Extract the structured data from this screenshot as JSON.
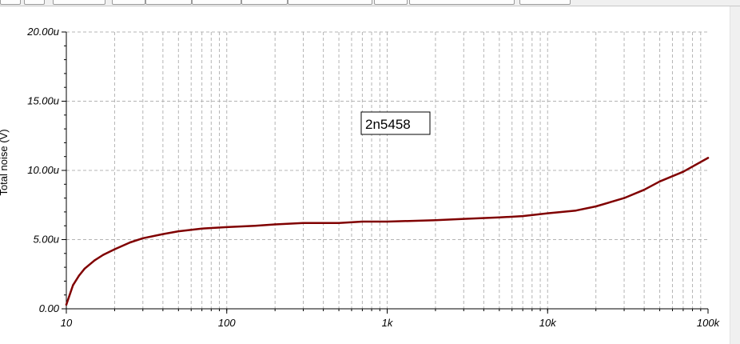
{
  "chart_data": {
    "type": "line",
    "title": "",
    "xlabel": "",
    "ylabel": "Total noise (V)",
    "x_scale": "log",
    "xlim": [
      10,
      100000
    ],
    "ylim": [
      0,
      2e-05
    ],
    "grid": true,
    "x_tick_values": [
      10,
      100,
      1000,
      10000,
      100000
    ],
    "x_tick_labels": [
      "10",
      "100",
      "1k",
      "10k",
      "100k"
    ],
    "y_tick_values": [
      0,
      5e-06,
      1e-05,
      1.5e-05,
      2e-05
    ],
    "y_tick_labels": [
      "0.00",
      "5.00u",
      "10.00u",
      "15.00u",
      "20.00u"
    ],
    "legend_label": "2n5458",
    "series": [
      {
        "name": "2n5458",
        "color": "#800000",
        "x": [
          10,
          11,
          12,
          13,
          15,
          17,
          20,
          25,
          30,
          40,
          50,
          70,
          100,
          150,
          200,
          300,
          500,
          700,
          1000,
          2000,
          3000,
          5000,
          7000,
          10000,
          15000,
          20000,
          30000,
          40000,
          50000,
          70000,
          100000
        ],
        "y": [
          3e-07,
          1.7e-06,
          2.4e-06,
          2.9e-06,
          3.5e-06,
          3.9e-06,
          4.3e-06,
          4.8e-06,
          5.1e-06,
          5.4e-06,
          5.6e-06,
          5.8e-06,
          5.9e-06,
          6e-06,
          6.1e-06,
          6.2e-06,
          6.2e-06,
          6.3e-06,
          6.3e-06,
          6.4e-06,
          6.5e-06,
          6.6e-06,
          6.7e-06,
          6.9e-06,
          7.1e-06,
          7.4e-06,
          8e-06,
          8.6e-06,
          9.2e-06,
          9.9e-06,
          1.09e-05
        ]
      }
    ]
  }
}
